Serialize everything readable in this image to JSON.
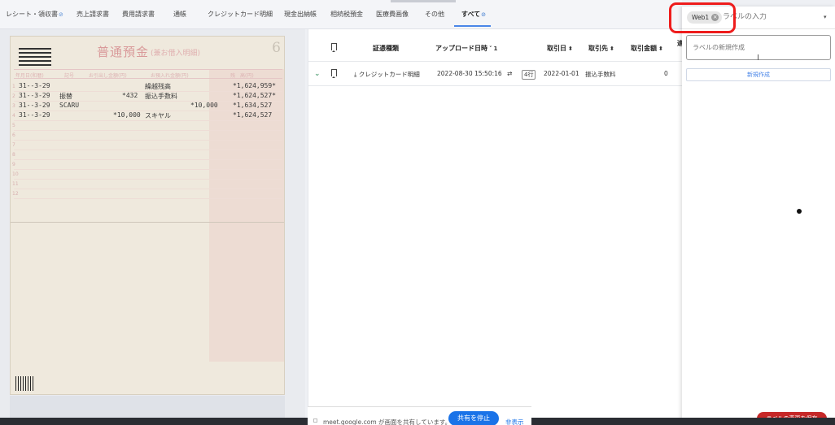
{
  "tabs": [
    {
      "label": "レシート・領収書",
      "verified": true
    },
    {
      "label": "売上請求書",
      "verified": false
    },
    {
      "label": "費用請求書",
      "verified": false
    },
    {
      "label": "通帳",
      "verified": false
    },
    {
      "label": "クレジットカード明細",
      "verified": false
    },
    {
      "label": "現金出納帳",
      "verified": false
    },
    {
      "label": "相続税預金",
      "verified": false
    },
    {
      "label": "医療費画像",
      "verified": false
    },
    {
      "label": "その他",
      "verified": false
    },
    {
      "label": "すべて",
      "verified": true,
      "active": true
    }
  ],
  "verified_icon": "⊘",
  "passbook": {
    "title": "普通預金",
    "title_sub": "(兼お借入明細)",
    "page_number": "6",
    "header_cols": [
      "年月日(和暦)",
      "記号",
      "お引出し金額(円)",
      "お預入れ金額(円)",
      "残　高(円)"
    ],
    "rows": [
      {
        "date": "31--3-29",
        "desc": "",
        "withdraw": "",
        "deposit": "",
        "memo": "繰越残高",
        "balance": "*1,624,959*"
      },
      {
        "date": "31--3-29",
        "desc": "振替",
        "withdraw": "*432",
        "deposit": "",
        "memo": "振込手数料",
        "balance": "*1,624,527*"
      },
      {
        "date": "31--3-29",
        "desc": "SCARU",
        "withdraw": "",
        "deposit": "*10,000",
        "memo": "",
        "balance": "*1,634,527"
      },
      {
        "date": "31--3-29",
        "desc": "",
        "withdraw": "*10,000",
        "deposit": "",
        "memo": "スキヤル",
        "balance": "*1,624,527"
      }
    ],
    "row_numbers": [
      "1",
      "2",
      "3",
      "4",
      "5",
      "6",
      "7",
      "8",
      "9",
      "10",
      "11",
      "12"
    ]
  },
  "table": {
    "headers": {
      "doc_type": "証憑種類",
      "upload_datetime": "アップロード日時",
      "upload_sort": "1",
      "trade_date": "取引日",
      "partner": "取引先",
      "amount": "取引金額",
      "extra": "適"
    },
    "sort_icon": "⬍",
    "desc_icon": "˅",
    "rows": [
      {
        "doc_type": "クレジットカード明細",
        "upload_datetime": "2022-08-30 15:50:16",
        "lines": "4行",
        "trade_date": "2022-01-01",
        "partner": "振込手数料",
        "amount": "0"
      }
    ]
  },
  "label_panel": {
    "chip_label": "Web1",
    "chip_remove": "×",
    "input_placeholder": "ラベルの入力",
    "caret": "▾",
    "new_label_placeholder": "ラベルの新規作成",
    "create_button": "新規作成",
    "save_button": "ラベルの変更を保存"
  },
  "meet": {
    "message": "meet.google.com が画面を共有しています。",
    "stop_button": "共有を停止",
    "hide_button": "非表示"
  }
}
